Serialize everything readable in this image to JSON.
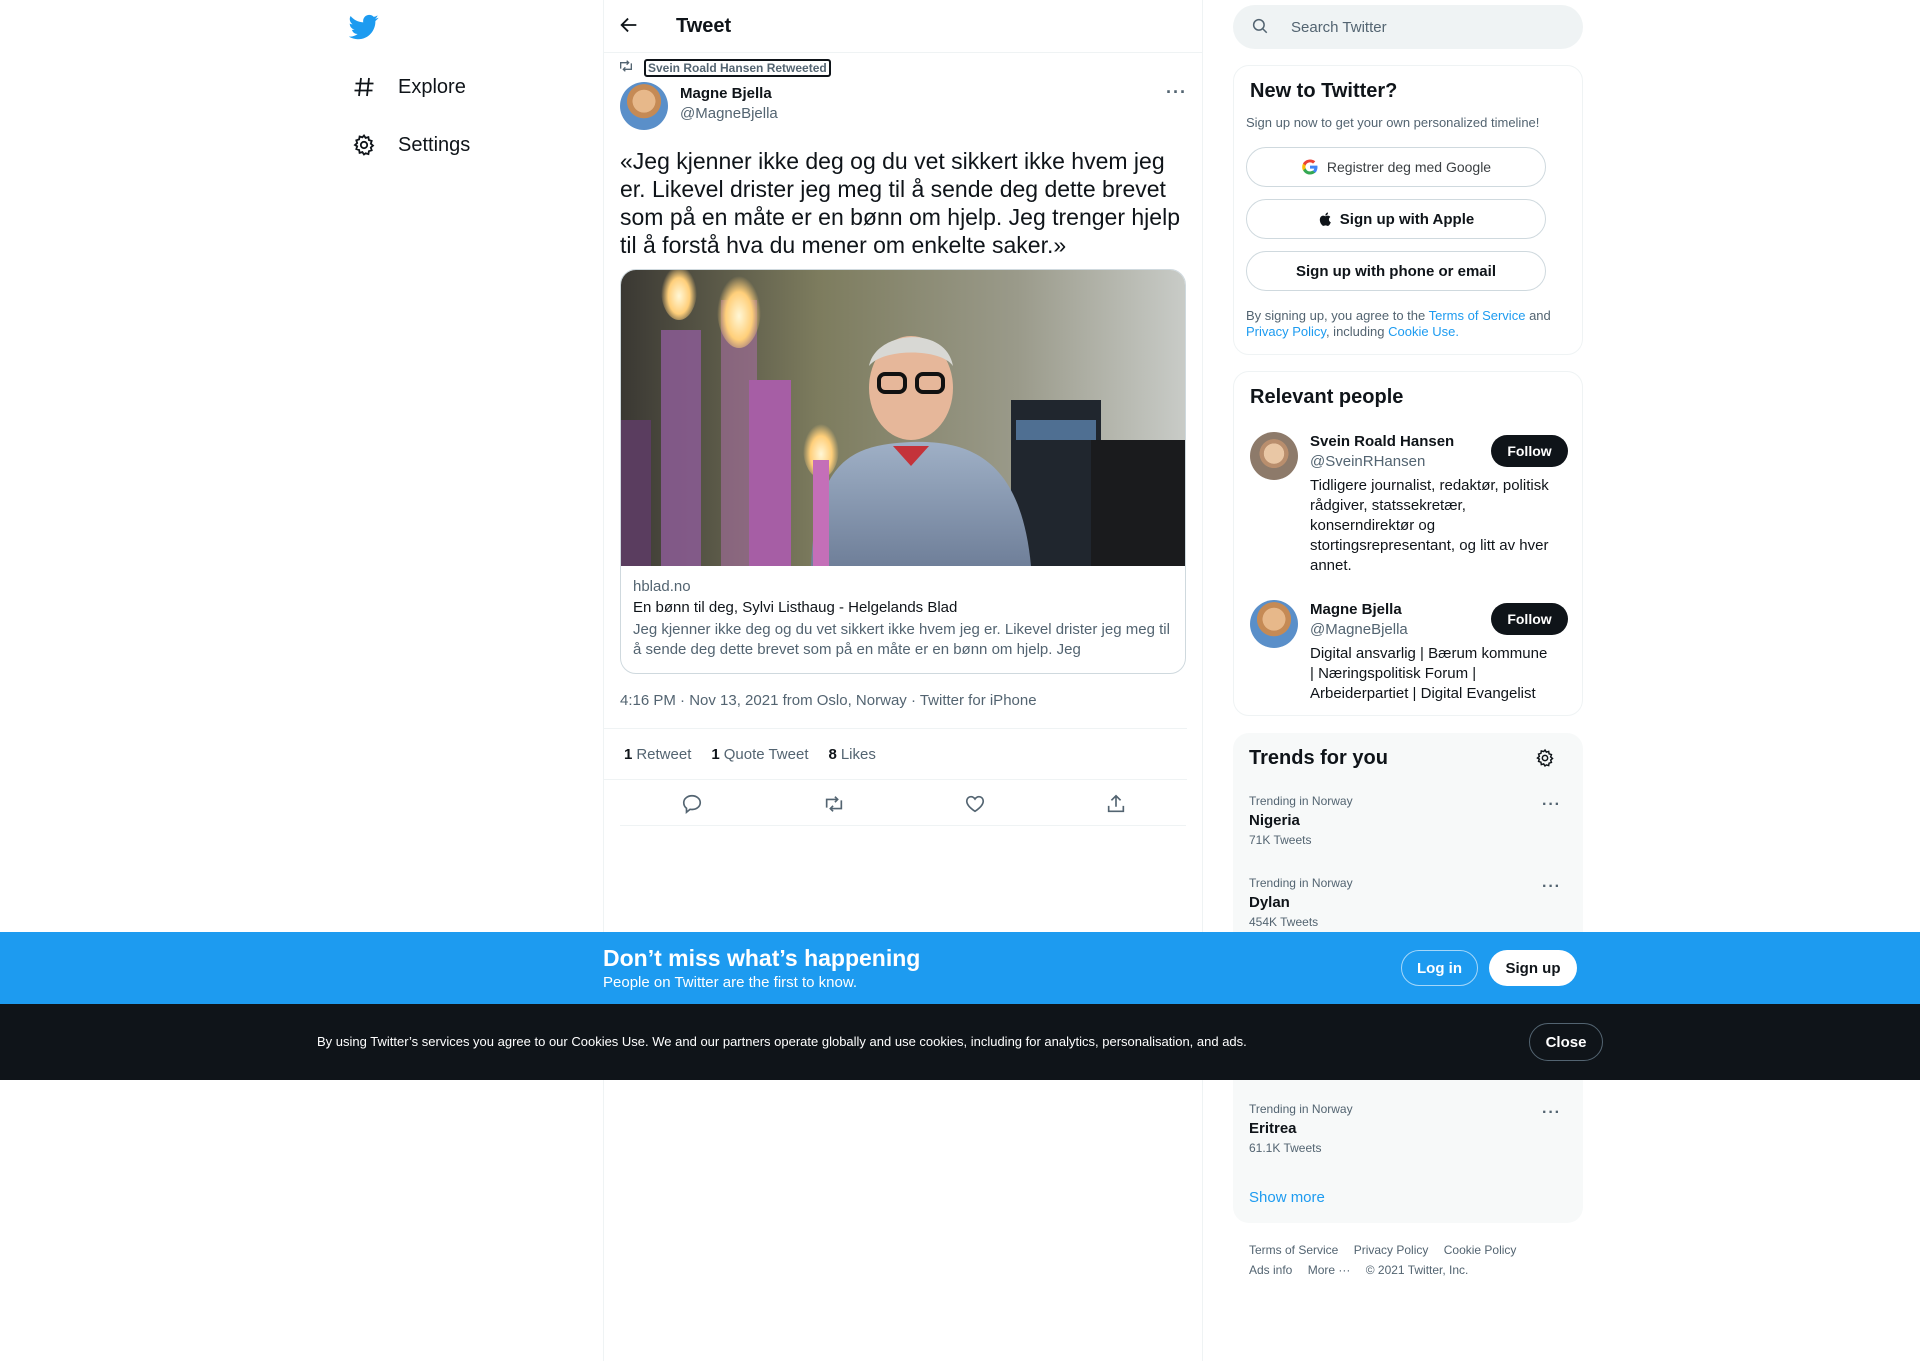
{
  "nav": {
    "logo_icon": "twitter-bird-icon",
    "items": [
      {
        "label": "Explore",
        "icon": "hashtag-icon"
      },
      {
        "label": "Settings",
        "icon": "gear-icon"
      }
    ]
  },
  "header": {
    "title": "Tweet",
    "back_icon": "arrow-left-icon"
  },
  "tweet": {
    "retweet_context": "Svein Roald Hansen Retweeted",
    "author_name": "Magne Bjella",
    "author_handle": "@MagneBjella",
    "text": "«Jeg kjenner ikke deg og du vet sikkert ikke hvem jeg er. Likevel drister jeg meg til å sende deg dette brevet som på en måte er en bønn om hjelp. Jeg trenger hjelp til å forstå hva du mener om enkelte saker.»",
    "card": {
      "domain": "hblad.no",
      "title": "En bønn til deg, Sylvi Listhaug - Helgelands Blad",
      "description": "Jeg kjenner ikke deg og du vet sikkert ikke hvem jeg er. Likevel drister jeg meg til å sende deg dette brevet som på en måte er en bønn om hjelp. Jeg"
    },
    "meta": "4:16 PM · Nov 13, 2021 from Oslo, Norway · Twitter for iPhone",
    "stats": {
      "retweets_count": "1",
      "retweets_label": "Retweet",
      "quotes_count": "1",
      "quotes_label": "Quote Tweet",
      "likes_count": "8",
      "likes_label": "Likes"
    }
  },
  "search": {
    "placeholder": "Search Twitter"
  },
  "signup_panel": {
    "title": "New to Twitter?",
    "subtitle": "Sign up now to get your own personalized timeline!",
    "google_label": "Registrer deg med Google",
    "apple_label": "Sign up with Apple",
    "phone_label": "Sign up with phone or email",
    "legal_prefix": "By signing up, you agree to the",
    "terms_link": "Terms of Service",
    "legal_and": "and",
    "privacy_link": "Privacy Policy",
    "legal_including": ", including",
    "cookie_link": "Cookie Use."
  },
  "relevant_people": {
    "title": "Relevant people",
    "people": [
      {
        "name": "Svein Roald Hansen",
        "handle": "@SveinRHansen",
        "bio": "Tidligere journalist, redaktør, politisk rådgiver, statssekretær, konserndirektør og stortingsrepresentant, og litt av hver annet.",
        "follow_label": "Follow"
      },
      {
        "name": "Magne Bjella",
        "handle": "@MagneBjella",
        "bio": "Digital ansvarlig | Bærum kommune | Næringspolitisk Forum | Arbeiderpartiet | Digital Evangelist",
        "follow_label": "Follow"
      }
    ]
  },
  "trends": {
    "title": "Trends for you",
    "items": [
      {
        "context": "Trending in Norway",
        "name": "Nigeria",
        "count": "71K Tweets"
      },
      {
        "context": "Trending in Norway",
        "name": "Dylan",
        "count": "454K Tweets"
      },
      {
        "context": "Trending in Norway",
        "name": "Eritrea",
        "count": "61.1K Tweets"
      }
    ],
    "show_more": "Show more"
  },
  "footer": {
    "links_row1": [
      "Terms of Service",
      "Privacy Policy",
      "Cookie Policy"
    ],
    "ads_info": "Ads info",
    "more": "More ···",
    "copyright": "© 2021 Twitter, Inc."
  },
  "banner": {
    "title": "Don’t miss what’s happening",
    "subtitle": "People on Twitter are the first to know.",
    "login_label": "Log in",
    "signup_label": "Sign up"
  },
  "cookie_bar": {
    "text": "By using Twitter’s services you agree to our Cookies Use. We and our partners operate globally and use cookies, including for analytics, personalisation, and ads.",
    "close_label": "Close"
  },
  "colors": {
    "accent": "#1d9bf0",
    "text": "#0f1419",
    "muted": "#536471",
    "cookie_bg": "#0f1419"
  }
}
